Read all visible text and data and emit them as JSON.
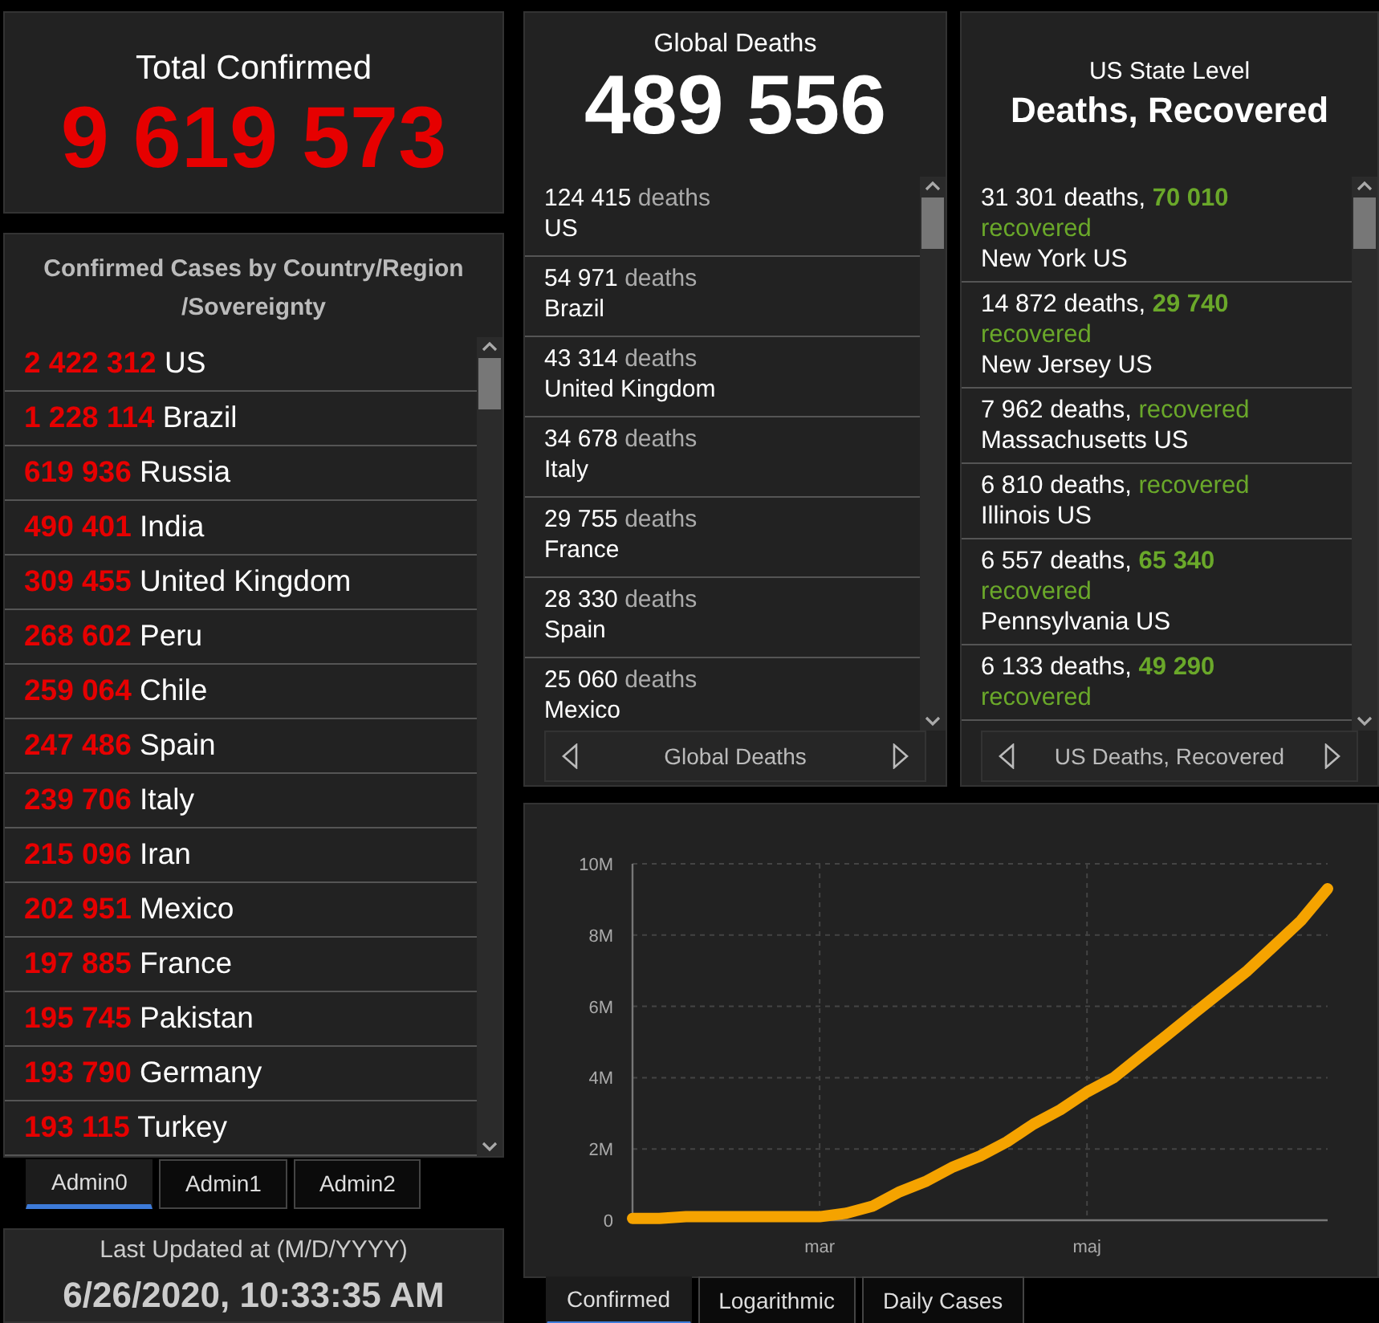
{
  "total_confirmed": {
    "title": "Total Confirmed",
    "value": "9 619 573"
  },
  "country_list": {
    "title": "Confirmed Cases by Country/Region /Sovereignty",
    "rows": [
      {
        "count": "2 422 312",
        "name": "US"
      },
      {
        "count": "1 228 114",
        "name": "Brazil"
      },
      {
        "count": "619 936",
        "name": "Russia"
      },
      {
        "count": "490 401",
        "name": "India"
      },
      {
        "count": "309 455",
        "name": "United Kingdom"
      },
      {
        "count": "268 602",
        "name": "Peru"
      },
      {
        "count": "259 064",
        "name": "Chile"
      },
      {
        "count": "247 486",
        "name": "Spain"
      },
      {
        "count": "239 706",
        "name": "Italy"
      },
      {
        "count": "215 096",
        "name": "Iran"
      },
      {
        "count": "202 951",
        "name": "Mexico"
      },
      {
        "count": "197 885",
        "name": "France"
      },
      {
        "count": "195 745",
        "name": "Pakistan"
      },
      {
        "count": "193 790",
        "name": "Germany"
      },
      {
        "count": "193 115",
        "name": "Turkey"
      }
    ]
  },
  "admin_tabs": [
    {
      "label": "Admin0",
      "selected": true
    },
    {
      "label": "Admin1",
      "selected": false
    },
    {
      "label": "Admin2",
      "selected": false
    }
  ],
  "last_updated": {
    "label": "Last Updated at (M/D/YYYY)",
    "value": "6/26/2020, 10:33:35 AM"
  },
  "global_deaths": {
    "title": "Global Deaths",
    "value": "489 556",
    "rows": [
      {
        "count": "124 415",
        "unit": "deaths",
        "name": "US"
      },
      {
        "count": "54 971",
        "unit": "deaths",
        "name": "Brazil"
      },
      {
        "count": "43 314",
        "unit": "deaths",
        "name": "United Kingdom"
      },
      {
        "count": "34 678",
        "unit": "deaths",
        "name": "Italy"
      },
      {
        "count": "29 755",
        "unit": "deaths",
        "name": "France"
      },
      {
        "count": "28 330",
        "unit": "deaths",
        "name": "Spain"
      },
      {
        "count": "25 060",
        "unit": "deaths",
        "name": "Mexico"
      }
    ],
    "pager": "Global Deaths"
  },
  "us_state_level": {
    "subtitle": "US State Level",
    "title": "Deaths, Recovered",
    "rows": [
      {
        "deaths": "31 301 deaths,",
        "recovered": "70 010",
        "recovered_label": "recovered",
        "state": "New York",
        "country": "US"
      },
      {
        "deaths": "14 872 deaths,",
        "recovered": "29 740",
        "recovered_label": "recovered",
        "state": "New Jersey",
        "country": "US"
      },
      {
        "deaths": "7 962 deaths,",
        "recovered_label": "recovered",
        "state": "Massachusetts",
        "country": "US"
      },
      {
        "deaths": "6 810 deaths,",
        "recovered_label": "recovered",
        "state": "Illinois",
        "country": "US"
      },
      {
        "deaths": "6 557 deaths,",
        "recovered": "65 340",
        "recovered_label": "recovered",
        "state": "Pennsylvania",
        "country": "US"
      },
      {
        "deaths": "6 133 deaths,",
        "recovered": "49 290",
        "recovered_label": "recovered"
      }
    ],
    "pager": "US Deaths, Recovered"
  },
  "chart": {
    "chart_data": {
      "type": "line",
      "categories": [
        null,
        null,
        null,
        null,
        null,
        null,
        null,
        "mar",
        null,
        null,
        null,
        null,
        null,
        null,
        null,
        null,
        null,
        "maj",
        null,
        null,
        null,
        null,
        null,
        null,
        null,
        null,
        null
      ],
      "series": [
        {
          "color": "#f5a300",
          "values": [
            50000,
            50000,
            100000,
            100000,
            100000,
            100000,
            100000,
            100000,
            200000,
            400000,
            800000,
            1100000,
            1500000,
            1800000,
            2200000,
            2700000,
            3100000,
            3600000,
            4000000,
            4600000,
            5200000,
            5800000,
            6400000,
            7000000,
            7700000,
            8400000,
            9300000
          ]
        }
      ],
      "grid": true,
      "ylim": [
        0,
        10000000
      ],
      "yticks": [
        {
          "value": 0,
          "label": "0"
        },
        {
          "value": 2000000,
          "label": "2M"
        },
        {
          "value": 4000000,
          "label": "4M"
        },
        {
          "value": 6000000,
          "label": "6M"
        },
        {
          "value": 8000000,
          "label": "8M"
        },
        {
          "value": 10000000,
          "label": "10M"
        }
      ]
    },
    "tabs": [
      {
        "label": "Confirmed",
        "selected": true
      },
      {
        "label": "Logarithmic",
        "selected": false
      },
      {
        "label": "Daily Cases",
        "selected": false
      }
    ]
  }
}
